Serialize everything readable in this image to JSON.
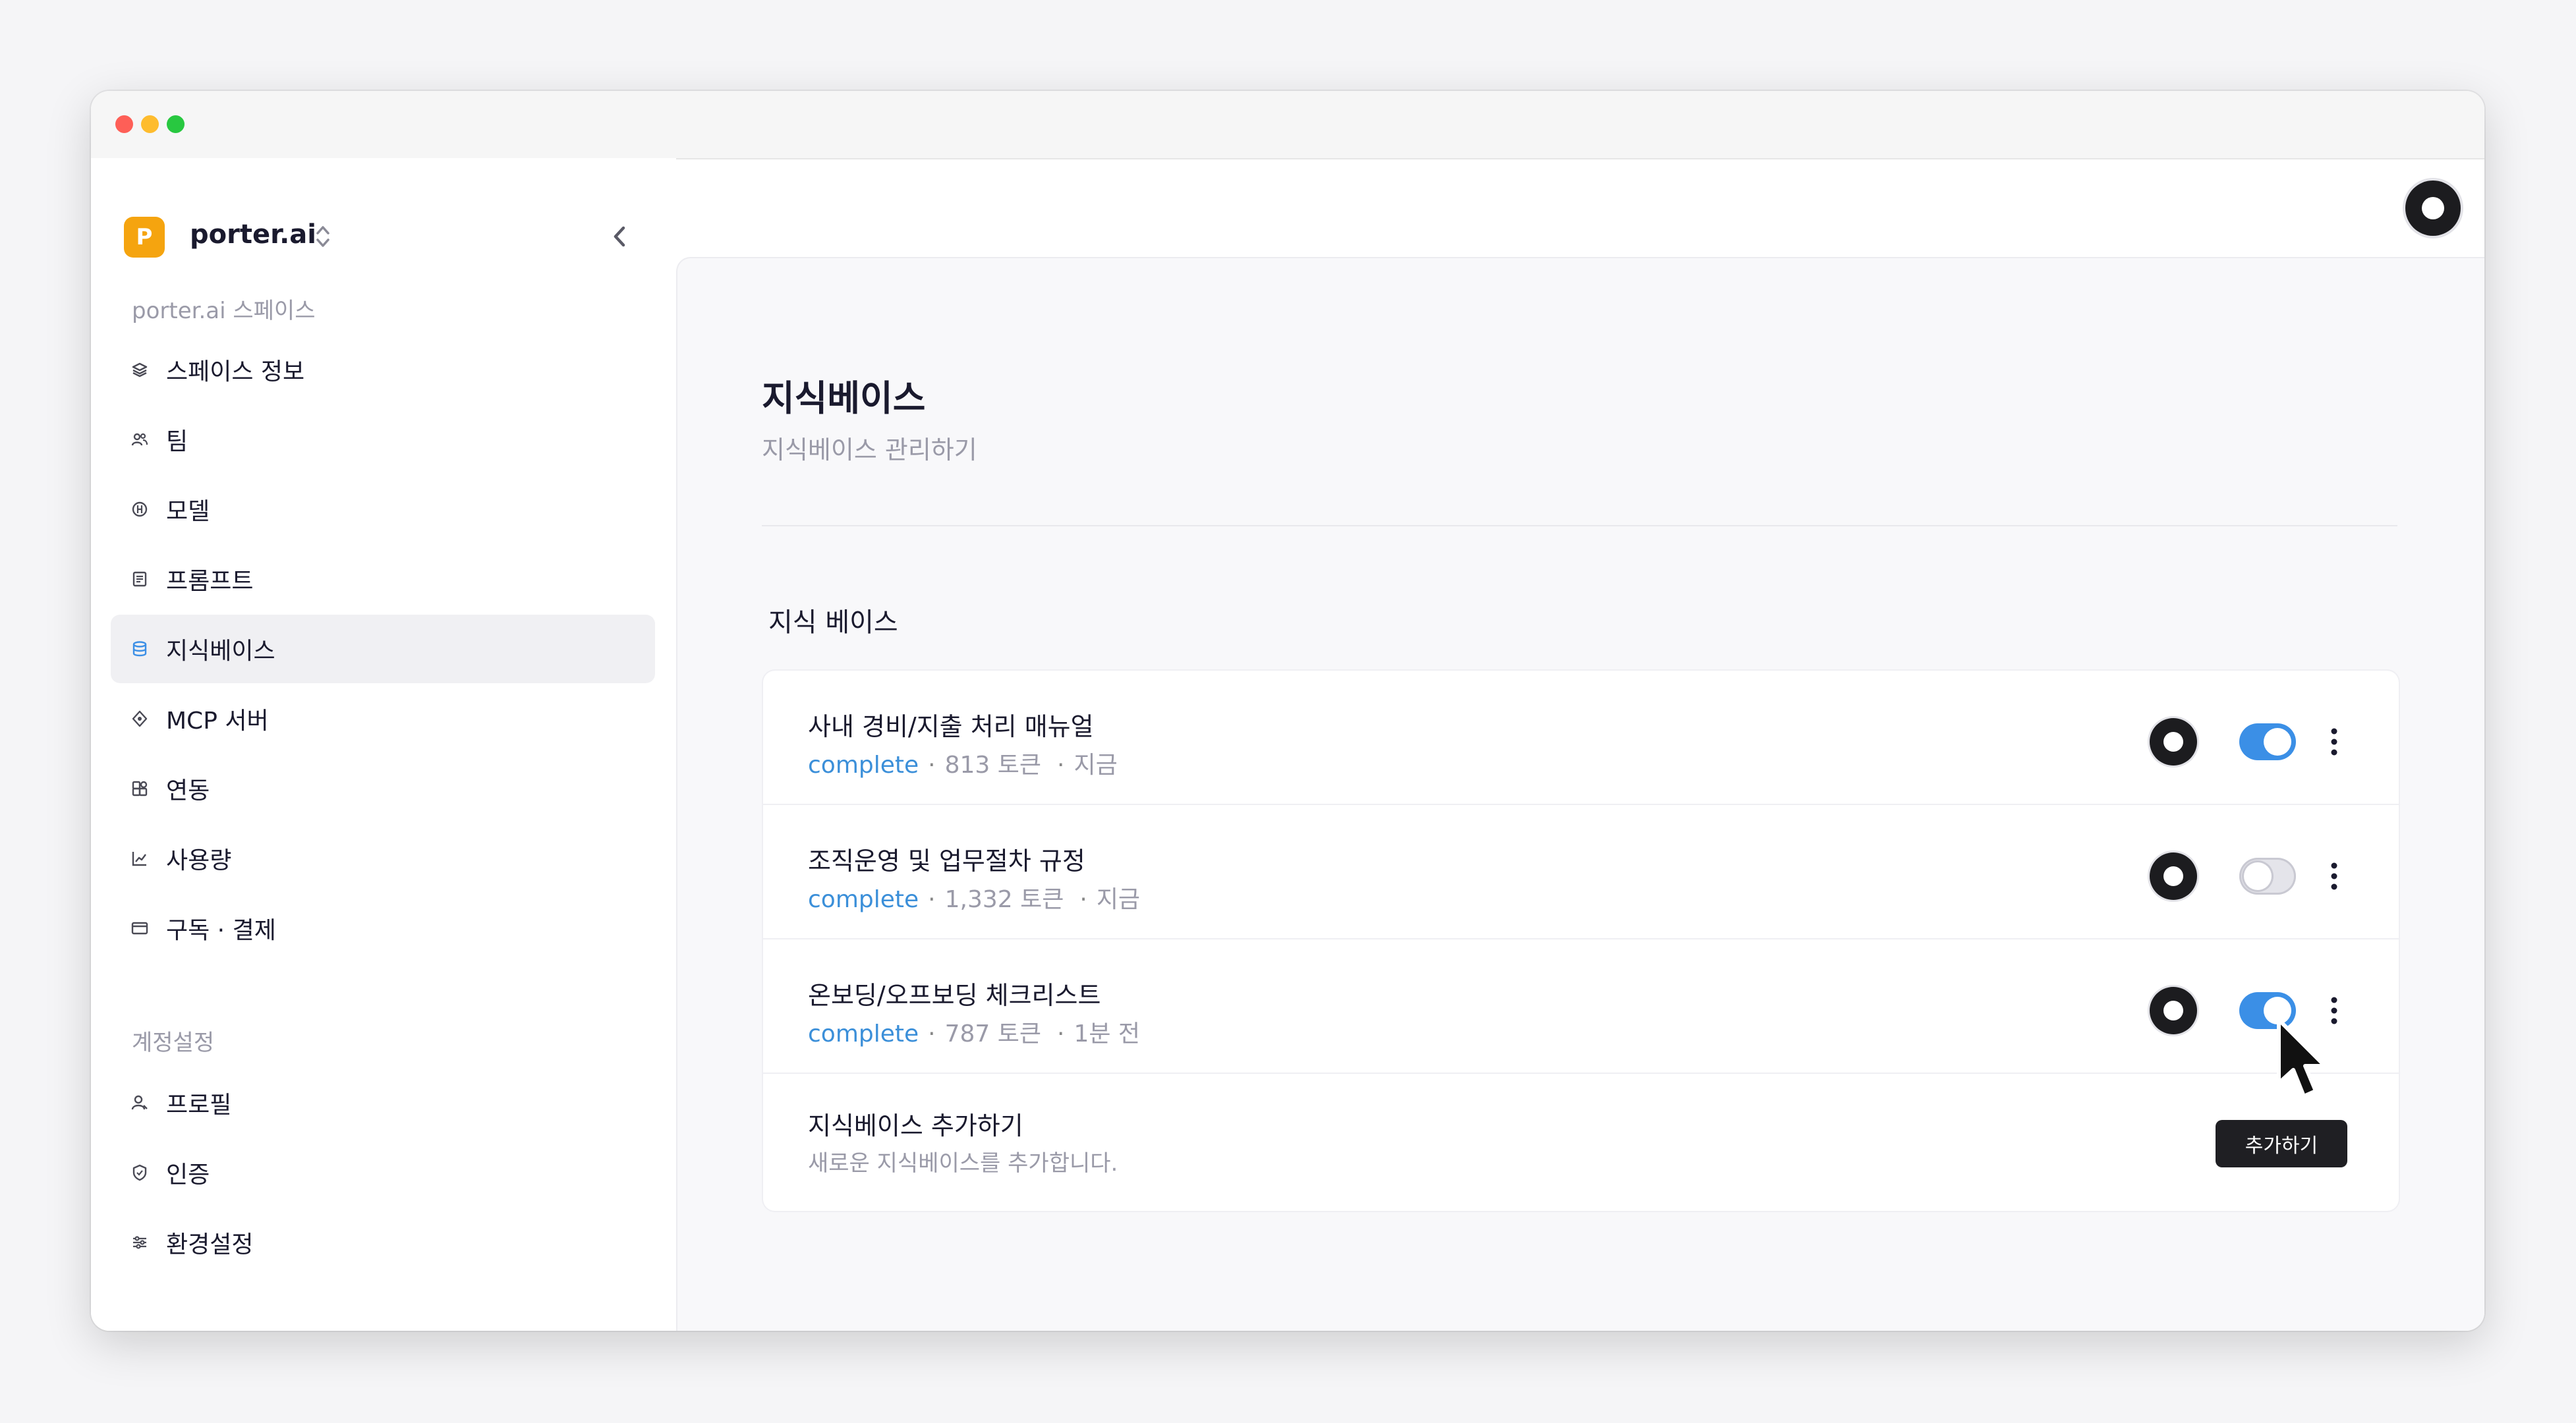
{
  "app": {
    "workspace_logo_letter": "P",
    "workspace_name": "porter.ai",
    "accent_color": "#3b8fe6",
    "logo_color": "#f5a40f"
  },
  "sidebar": {
    "section_space": "porter.ai 스페이스",
    "space_items": [
      {
        "label": "스페이스 정보",
        "icon": "layers-icon"
      },
      {
        "label": "팀",
        "icon": "users-icon"
      },
      {
        "label": "모델",
        "icon": "model-icon"
      },
      {
        "label": "프롬프트",
        "icon": "prompt-icon"
      },
      {
        "label": "지식베이스",
        "icon": "database-icon",
        "active": true
      },
      {
        "label": "MCP 서버",
        "icon": "mcp-icon"
      },
      {
        "label": "연동",
        "icon": "integration-icon"
      },
      {
        "label": "사용량",
        "icon": "chart-icon"
      },
      {
        "label": "구독 · 결제",
        "icon": "card-icon"
      }
    ],
    "section_account": "계정설정",
    "account_items": [
      {
        "label": "프로필",
        "icon": "user-icon"
      },
      {
        "label": "인증",
        "icon": "shield-icon"
      },
      {
        "label": "환경설정",
        "icon": "sliders-icon"
      }
    ]
  },
  "page": {
    "title": "지식베이스",
    "subtitle": "지식베이스 관리하기",
    "section_title": "지식 베이스"
  },
  "knowledge_bases": [
    {
      "title": "사내 경비/지출 처리 매뉴얼",
      "status": "complete",
      "tokens": "813 토큰",
      "time": "지금",
      "enabled": true
    },
    {
      "title": "조직운영 및 업무절차 규정",
      "status": "complete",
      "tokens": "1,332 토큰",
      "time": "지금",
      "enabled": false
    },
    {
      "title": "온보딩/오프보딩 체크리스트",
      "status": "complete",
      "tokens": "787 토큰",
      "time": "1분 전",
      "enabled": true
    }
  ],
  "add_kb": {
    "title": "지식베이스 추가하기",
    "subtitle": "새로운 지식베이스를 추가합니다.",
    "button_label": "추가하기"
  }
}
